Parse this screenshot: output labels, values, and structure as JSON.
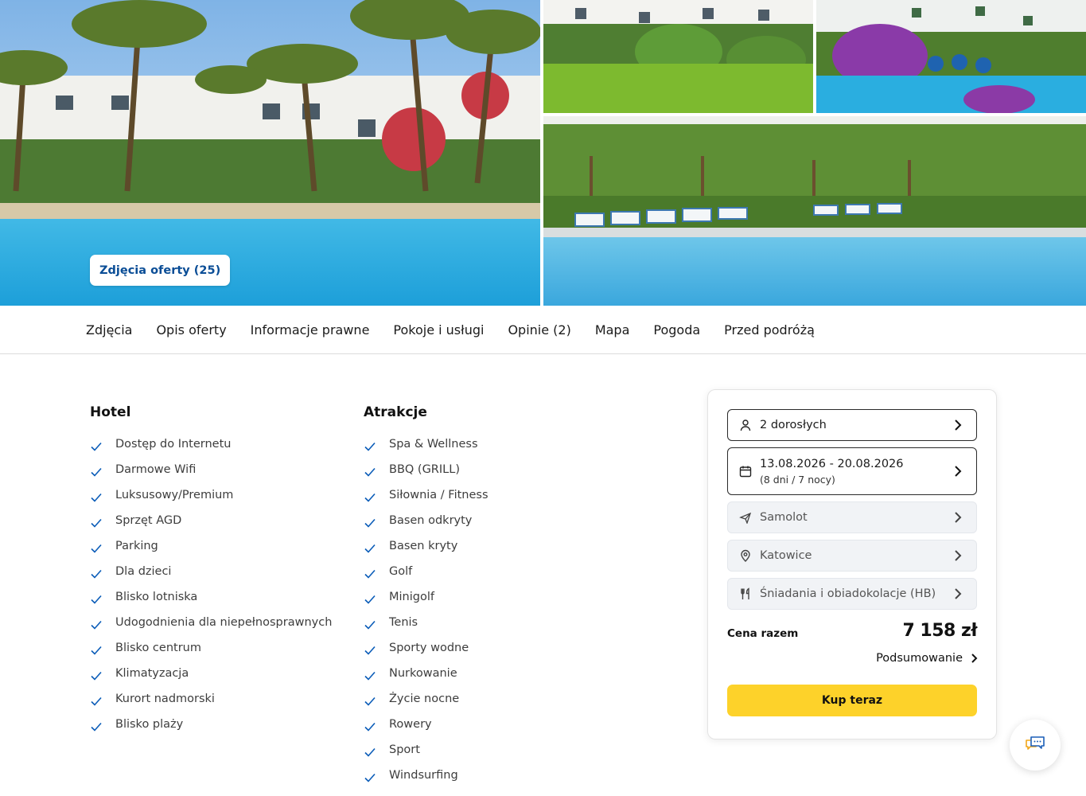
{
  "gallery": {
    "photos_button_label": "Zdjęcia oferty (25)"
  },
  "tabs": [
    "Zdjęcia",
    "Opis oferty",
    "Informacje prawne",
    "Pokoje i usługi",
    "Opinie (2)",
    "Mapa",
    "Pogoda",
    "Przed podróżą"
  ],
  "hotel": {
    "title": "Hotel",
    "items": [
      "Dostęp do Internetu",
      "Darmowe Wifi",
      "Luksusowy/Premium",
      "Sprzęt AGD",
      "Parking",
      "Dla dzieci",
      "Blisko lotniska",
      "Udogodnienia dla niepełnosprawnych",
      "Blisko centrum",
      "Klimatyzacja",
      "Kurort nadmorski",
      "Blisko plaży"
    ]
  },
  "attractions": {
    "title": "Atrakcje",
    "items": [
      "Spa & Wellness",
      "BBQ (GRILL)",
      "Siłownia / Fitness",
      "Basen odkryty",
      "Basen kryty",
      "Golf",
      "Minigolf",
      "Tenis",
      "Sporty wodne",
      "Nurkowanie",
      "Życie nocne",
      "Rowery",
      "Sport",
      "Windsurfing"
    ]
  },
  "booking": {
    "travelers": "2 dorosłych",
    "dates": "13.08.2026 - 20.08.2026",
    "duration": "(8 dni / 7 nocy)",
    "transport": "Samolot",
    "departure": "Katowice",
    "board": "Śniadania i obiadokolacje (HB)",
    "total_label": "Cena razem",
    "total_price": "7 158 zł",
    "summary_label": "Podsumowanie",
    "buy_label": "Kup teraz"
  },
  "colors": {
    "brand_blue": "#0a4d96",
    "buy_yellow": "#fdd22a",
    "check_blue": "#0a5cb8"
  },
  "icons": {
    "travelers": "person-icon",
    "dates": "calendar-icon",
    "transport": "plane-icon",
    "departure": "location-pin-icon",
    "board": "cutlery-icon",
    "chat": "chat-icon"
  }
}
